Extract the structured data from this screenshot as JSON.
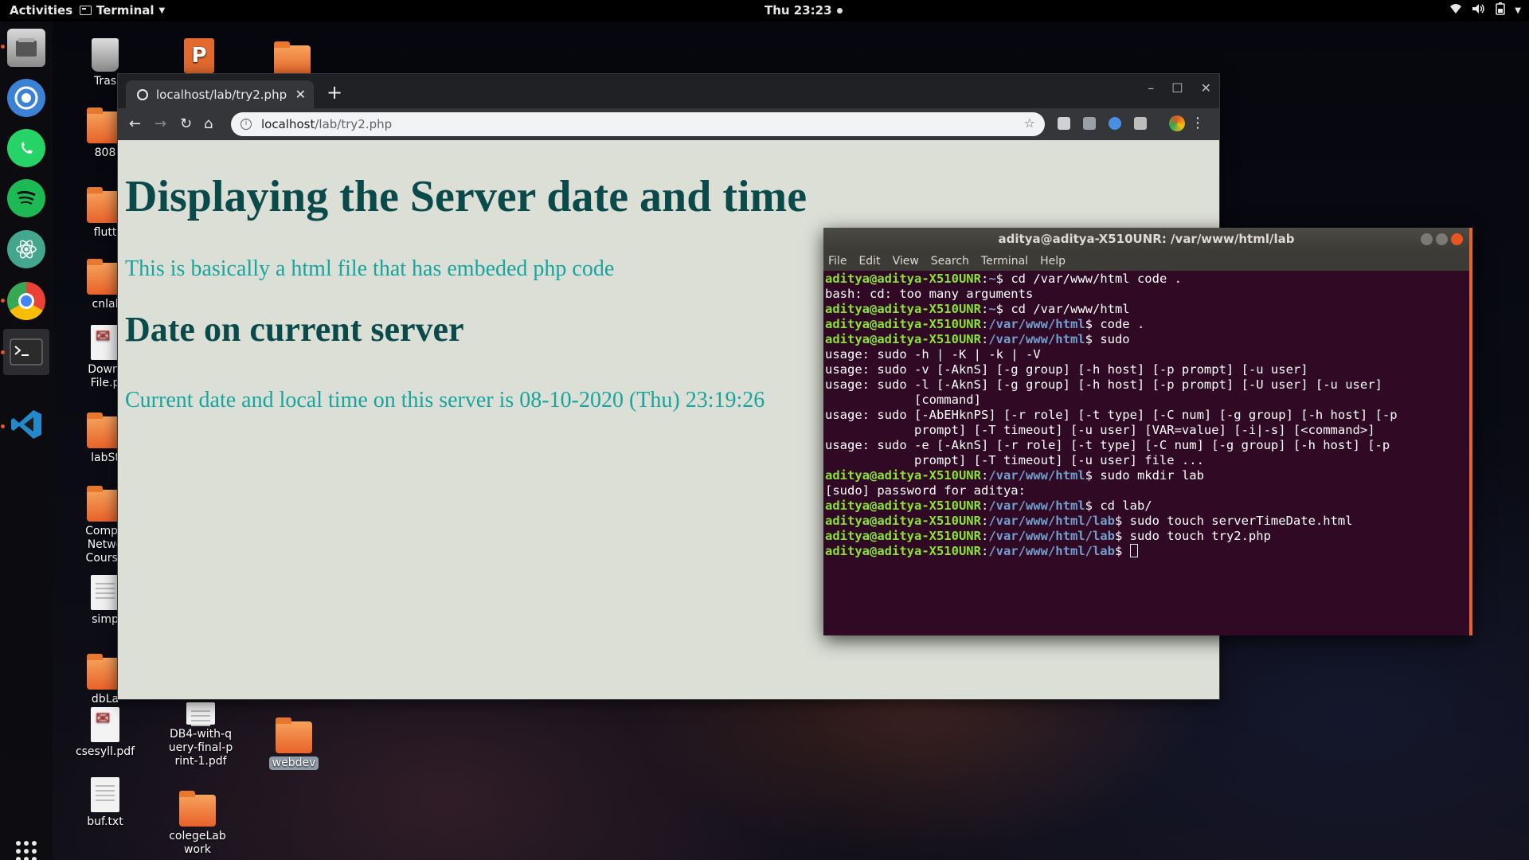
{
  "topbar": {
    "activities": "Activities",
    "app_name": "Terminal",
    "clock": "Thu 23:23"
  },
  "desktop_icons": [
    {
      "label": "Tras",
      "kind": "trash"
    },
    {
      "label": "808",
      "kind": "folder"
    },
    {
      "label": "flutt",
      "kind": "folder"
    },
    {
      "label": "cnlal",
      "kind": "folder"
    },
    {
      "label": "Downl File.p",
      "kind": "pdf"
    },
    {
      "label": "labSt",
      "kind": "folder"
    },
    {
      "label": "Compu Netwo Course",
      "kind": "folder"
    },
    {
      "label": "simp",
      "kind": "doc"
    },
    {
      "label": "dbLa",
      "kind": "folder"
    },
    {
      "label": "csesyll.pdf",
      "kind": "pdf"
    },
    {
      "label": "buf.txt",
      "kind": "doc"
    },
    {
      "label": "DB4-with-query-final-print-1.pdf",
      "kind": "doc"
    },
    {
      "label": "colegeLab work",
      "kind": "folder"
    },
    {
      "label": "webdev",
      "kind": "folder"
    }
  ],
  "browser": {
    "tab_title": "localhost/lab/try2.php",
    "url_host": "localhost",
    "url_path": "/lab/try2.php",
    "page": {
      "heading": "Displaying the Server date and time",
      "paragraph": "This is basically a html file that has embeded php code",
      "subheading": "Date on current server",
      "datetime_text": "Current date and local time on this server is 08-10-2020 (Thu) 23:19:26"
    }
  },
  "terminal": {
    "title": "aditya@aditya-X510UNR: /var/www/html/lab",
    "menu": [
      "File",
      "Edit",
      "View",
      "Search",
      "Terminal",
      "Help"
    ],
    "lines": [
      {
        "user": "aditya@aditya-X510UNR",
        "path": "~",
        "cmd": " cd /var/www/html code ."
      },
      {
        "text": "bash: cd: too many arguments"
      },
      {
        "user": "aditya@aditya-X510UNR",
        "path": "~",
        "cmd": " cd /var/www/html"
      },
      {
        "user": "aditya@aditya-X510UNR",
        "path": "/var/www/html",
        "cmd": " code ."
      },
      {
        "user": "aditya@aditya-X510UNR",
        "path": "/var/www/html",
        "cmd": " sudo"
      },
      {
        "text": "usage: sudo -h | -K | -k | -V"
      },
      {
        "text": "usage: sudo -v [-AknS] [-g group] [-h host] [-p prompt] [-u user]"
      },
      {
        "text": "usage: sudo -l [-AknS] [-g group] [-h host] [-p prompt] [-U user] [-u user]"
      },
      {
        "text": "            [command]"
      },
      {
        "text": "usage: sudo [-AbEHknPS] [-r role] [-t type] [-C num] [-g group] [-h host] [-p"
      },
      {
        "text": "            prompt] [-T timeout] [-u user] [VAR=value] [-i|-s] [<command>]"
      },
      {
        "text": "usage: sudo -e [-AknS] [-r role] [-t type] [-C num] [-g group] [-h host] [-p"
      },
      {
        "text": "            prompt] [-T timeout] [-u user] file ..."
      },
      {
        "user": "aditya@aditya-X510UNR",
        "path": "/var/www/html",
        "cmd": " sudo mkdir lab"
      },
      {
        "text": "[sudo] password for aditya:"
      },
      {
        "user": "aditya@aditya-X510UNR",
        "path": "/var/www/html",
        "cmd": " cd lab/"
      },
      {
        "user": "aditya@aditya-X510UNR",
        "path": "/var/www/html/lab",
        "cmd": " sudo touch serverTimeDate.html"
      },
      {
        "user": "aditya@aditya-X510UNR",
        "path": "/var/www/html/lab",
        "cmd": " sudo touch try2.php"
      },
      {
        "user": "aditya@aditya-X510UNR",
        "path": "/var/www/html/lab",
        "cmd": " ",
        "cursor": true
      }
    ]
  },
  "colors": {
    "terminal_bg": "#300a24",
    "prompt_user": "#8ae234",
    "prompt_path": "#729fcf",
    "heading": "#0b4a4b",
    "body_text": "#17a5a0",
    "page_bg": "#dcdfd6"
  }
}
